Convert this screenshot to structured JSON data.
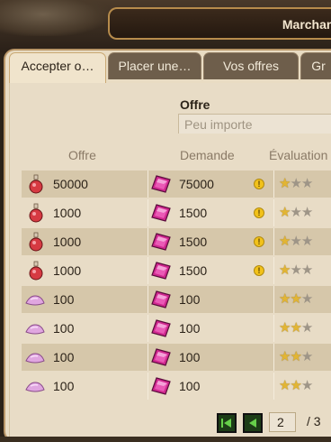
{
  "window": {
    "title": "Marchand"
  },
  "tabs": [
    {
      "label": "Accepter o…",
      "active": true
    },
    {
      "label": "Placer une…",
      "active": false
    },
    {
      "label": "Vos offres",
      "active": false
    },
    {
      "label": "Gr",
      "active": false
    }
  ],
  "filter": {
    "label": "Offre",
    "value": "Peu importe"
  },
  "columns": {
    "offer": "Offre",
    "demand": "Demande",
    "rating": "Évaluation"
  },
  "rows": [
    {
      "offer_icon": "red-potion-icon",
      "offer": "50000",
      "demand_icon": "pink-gem-icon",
      "demand": "75000",
      "warning": true,
      "stars": 1
    },
    {
      "offer_icon": "red-potion-icon",
      "offer": "1000",
      "demand_icon": "pink-gem-icon",
      "demand": "1500",
      "warning": true,
      "stars": 1
    },
    {
      "offer_icon": "red-potion-icon",
      "offer": "1000",
      "demand_icon": "pink-gem-icon",
      "demand": "1500",
      "warning": true,
      "stars": 1
    },
    {
      "offer_icon": "red-potion-icon",
      "offer": "1000",
      "demand_icon": "pink-gem-icon",
      "demand": "1500",
      "warning": true,
      "stars": 1
    },
    {
      "offer_icon": "pink-crystal-icon",
      "offer": "100",
      "demand_icon": "pink-gem-icon",
      "demand": "100",
      "warning": false,
      "stars": 2
    },
    {
      "offer_icon": "pink-crystal-icon",
      "offer": "100",
      "demand_icon": "pink-gem-icon",
      "demand": "100",
      "warning": false,
      "stars": 2
    },
    {
      "offer_icon": "pink-crystal-icon",
      "offer": "100",
      "demand_icon": "pink-gem-icon",
      "demand": "100",
      "warning": false,
      "stars": 2
    },
    {
      "offer_icon": "pink-crystal-icon",
      "offer": "100",
      "demand_icon": "pink-gem-icon",
      "demand": "100",
      "warning": false,
      "stars": 2
    }
  ],
  "warning_symbol": "!",
  "star_glyph": "★",
  "pagination": {
    "current": "2",
    "total": "/ 3"
  },
  "colors": {
    "panel": "#e9dcc3",
    "row_alt": "#d6c7aa",
    "frame": "#2b2218",
    "accent_green": "#2f7a1f",
    "gem": "#d0288f"
  }
}
